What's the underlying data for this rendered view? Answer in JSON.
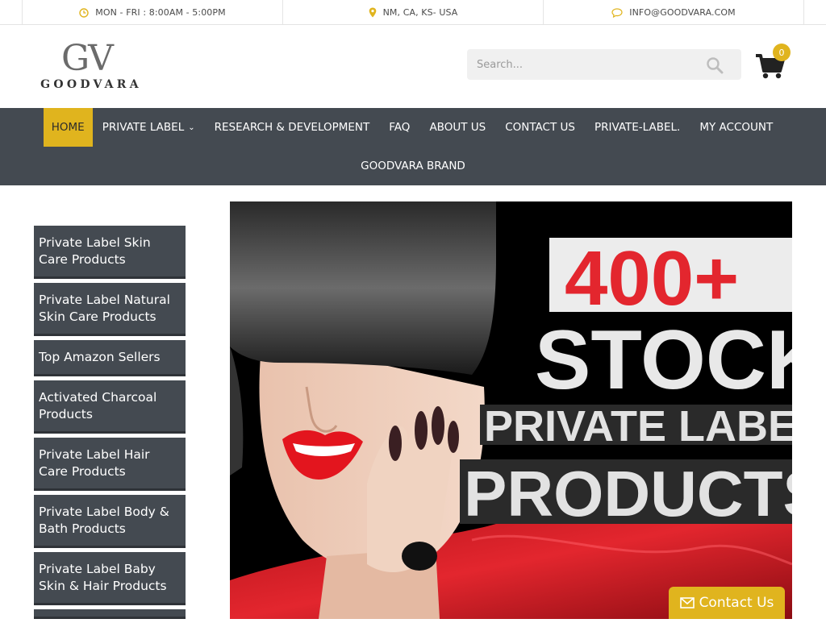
{
  "topbar": {
    "hours": "MON - FRI : 8:00AM - 5:00PM",
    "location": "NM, CA, KS- USA",
    "email": "INFO@GOODVARA.COM"
  },
  "logo": {
    "monogram": "GV",
    "wordmark": "GOODVARA"
  },
  "search": {
    "placeholder": "Search..."
  },
  "cart": {
    "count": "0"
  },
  "nav": {
    "items": [
      {
        "label": "HOME"
      },
      {
        "label": "PRIVATE LABEL"
      },
      {
        "label": "RESEARCH & DEVELOPMENT"
      },
      {
        "label": "FAQ"
      },
      {
        "label": "ABOUT US"
      },
      {
        "label": "CONTACT US"
      },
      {
        "label": "PRIVATE-LABEL."
      },
      {
        "label": "MY ACCOUNT"
      },
      {
        "label": "GOODVARA BRAND"
      }
    ]
  },
  "sidebar": {
    "items": [
      {
        "label": "Private Label Skin Care Products"
      },
      {
        "label": "Private Label Natural Skin Care Products"
      },
      {
        "label": "Top Amazon Sellers"
      },
      {
        "label": "Activated Charcoal Products"
      },
      {
        "label": "Private Label Hair Care Products"
      },
      {
        "label": "Private Label Body & Bath Products"
      },
      {
        "label": "Private Label Baby Skin & Hair Products"
      }
    ]
  },
  "hero": {
    "line1": "400+",
    "line2": "STOCK",
    "line3": "PRIVATE LABEL",
    "line4": "PRODUCTS"
  },
  "contact_button": {
    "label": "Contact Us"
  },
  "colors": {
    "accent": "#e0b41e",
    "nav_bg": "#444a51",
    "hero_red": "#e3262e"
  }
}
